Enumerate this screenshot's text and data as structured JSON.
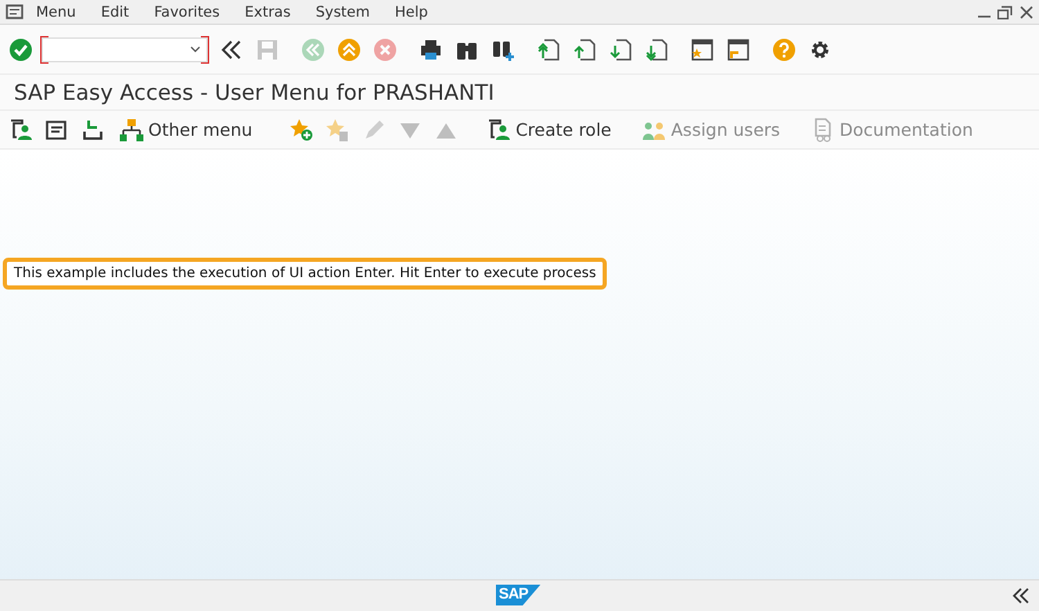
{
  "menu_bar": {
    "items": [
      {
        "label": "Menu"
      },
      {
        "label": "Edit"
      },
      {
        "label": "Favorites"
      },
      {
        "label": "Extras"
      },
      {
        "label": "System"
      },
      {
        "label": "Help"
      }
    ]
  },
  "system_toolbar": {
    "buttons": [
      {
        "disabled": false
      },
      {
        "disabled": true
      },
      {
        "disabled": true
      },
      {
        "disabled": false
      },
      {
        "disabled": true
      },
      {
        "disabled": false
      },
      {
        "disabled": false
      },
      {
        "disabled": false
      },
      {
        "disabled": false
      },
      {
        "disabled": false
      },
      {
        "disabled": false
      },
      {
        "disabled": false
      },
      {
        "disabled": false
      },
      {
        "disabled": false
      },
      {
        "disabled": false
      },
      {
        "disabled": false
      }
    ]
  },
  "title": "SAP Easy Access  -  User Menu for PRASHANTI",
  "app_toolbar": [
    {
      "kind": "icon",
      "disabled": false
    },
    {
      "kind": "icon",
      "disabled": false
    },
    {
      "kind": "icon",
      "disabled": false
    },
    {
      "kind": "labeled",
      "label": "Other menu",
      "disabled": false
    },
    {
      "kind": "icon",
      "disabled": false
    },
    {
      "kind": "icon",
      "disabled": true
    },
    {
      "kind": "icon",
      "disabled": true
    },
    {
      "kind": "icon",
      "disabled": true
    },
    {
      "kind": "icon",
      "disabled": true
    },
    {
      "kind": "labeled",
      "label": "Create role",
      "disabled": false
    },
    {
      "kind": "labeled",
      "label": "Assign users",
      "disabled": true
    },
    {
      "kind": "labeled",
      "label": "Documentation",
      "disabled": true
    }
  ],
  "callout": "This example includes the execution of UI action Enter. Hit Enter to execute process",
  "status_bar": {
    "logo": "SAP"
  }
}
